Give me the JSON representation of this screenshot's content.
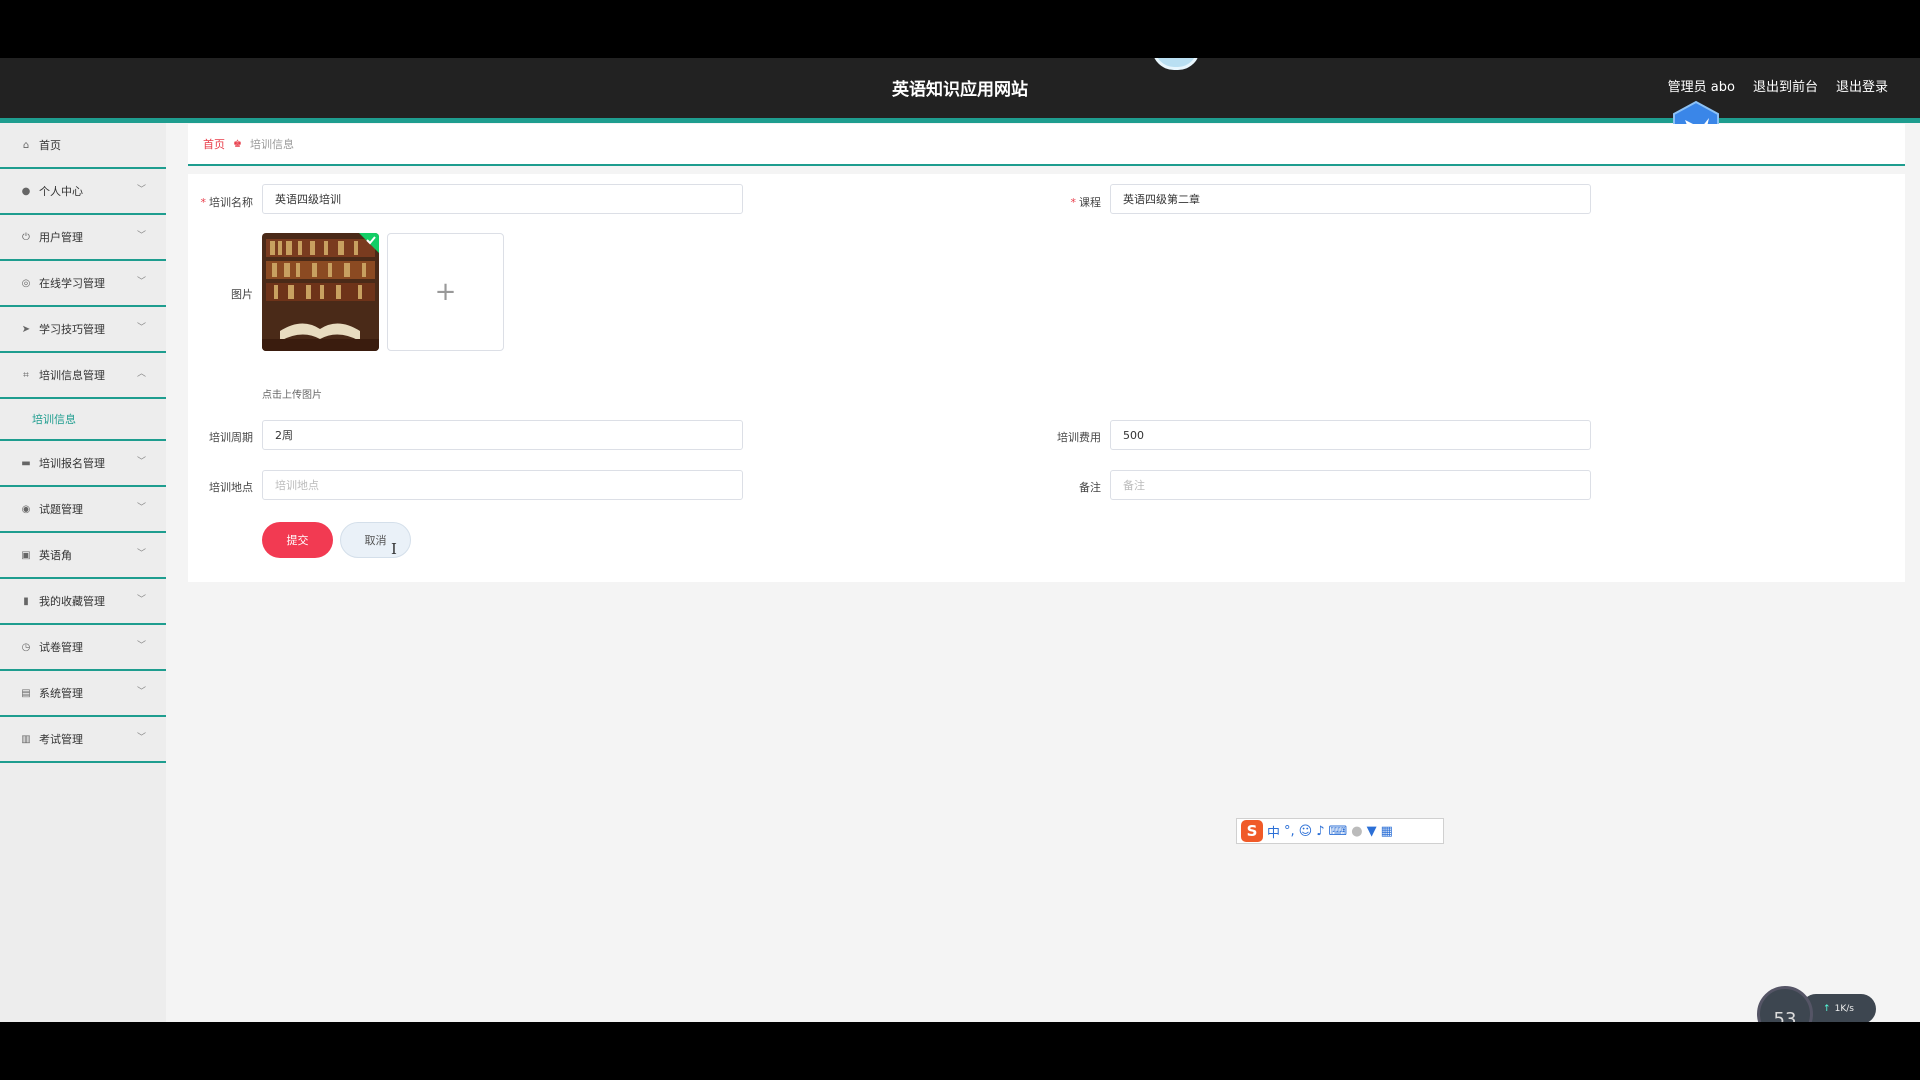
{
  "header": {
    "title": "英语知识应用网站",
    "admin_label": "管理员 abo",
    "front_label": "退出到前台",
    "logout_label": "退出登录"
  },
  "sidebar": {
    "items": [
      {
        "label": "首页",
        "icon": "home-icon"
      },
      {
        "label": "个人中心",
        "icon": "user-icon"
      },
      {
        "label": "用户管理",
        "icon": "power-icon"
      },
      {
        "label": "在线学习管理",
        "icon": "compass-icon"
      },
      {
        "label": "学习技巧管理",
        "icon": "send-icon"
      },
      {
        "label": "培训信息管理",
        "icon": "crop-icon",
        "expanded": true,
        "sub": "培训信息"
      },
      {
        "label": "培训报名管理",
        "icon": "chat-icon"
      },
      {
        "label": "试题管理",
        "icon": "target-icon"
      },
      {
        "label": "英语角",
        "icon": "briefcase-icon"
      },
      {
        "label": "我的收藏管理",
        "icon": "bookmark-icon"
      },
      {
        "label": "试卷管理",
        "icon": "clock-icon"
      },
      {
        "label": "系统管理",
        "icon": "clipboard-icon"
      },
      {
        "label": "考试管理",
        "icon": "clipboard-check-icon"
      }
    ]
  },
  "breadcrumb": {
    "home": "首页",
    "current": "培训信息"
  },
  "form": {
    "name_label": "培训名称",
    "name_value": "英语四级培训",
    "course_label": "课程",
    "course_value": "英语四级第二章",
    "image_label": "图片",
    "upload_plus": "+",
    "upload_hint": "点击上传图片",
    "period_label": "培训周期",
    "period_value": "2周",
    "fee_label": "培训费用",
    "fee_value": "500",
    "location_label": "培训地点",
    "location_placeholder": "培训地点",
    "remark_label": "备注",
    "remark_placeholder": "备注",
    "submit_label": "提交",
    "cancel_label": "取消"
  },
  "ime": {
    "logo": "S",
    "mode": "中",
    "punct": "°,",
    "icons": [
      "emoji-icon",
      "mic-icon",
      "keyboard-icon",
      "user-icon",
      "skin-icon",
      "grid-icon"
    ]
  },
  "speed": {
    "percent": "53",
    "rate": "1K/s"
  },
  "colors": {
    "accent": "#1e9d8f",
    "submit": "#f23a52",
    "header_bg": "#222222"
  }
}
